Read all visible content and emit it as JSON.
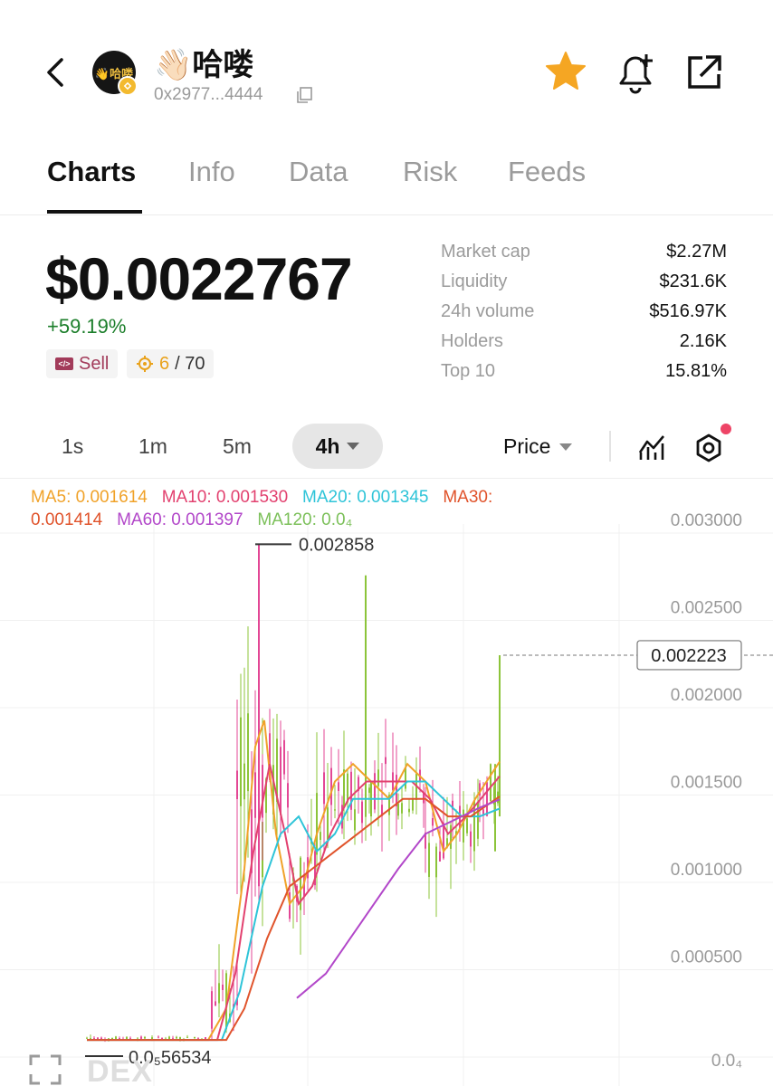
{
  "header": {
    "token_name": "👋🏻哈喽",
    "avatar_text": "👋哈喽",
    "address": "0x2977...4444"
  },
  "tabs": [
    {
      "label": "Charts",
      "active": true
    },
    {
      "label": "Info"
    },
    {
      "label": "Data"
    },
    {
      "label": "Risk"
    },
    {
      "label": "Feeds"
    }
  ],
  "summary": {
    "price": "$0.0022767",
    "change": "+59.19%",
    "sell_label": "Sell",
    "score_value": "6",
    "score_total": "/ 70"
  },
  "stats": [
    {
      "label": "Market cap",
      "value": "$2.27M"
    },
    {
      "label": "Liquidity",
      "value": "$231.6K"
    },
    {
      "label": "24h volume",
      "value": "$516.97K"
    },
    {
      "label": "Holders",
      "value": "2.16K"
    },
    {
      "label": "Top 10",
      "value": "15.81%"
    }
  ],
  "timeframes": [
    "1s",
    "1m",
    "5m"
  ],
  "active_timeframe": "4h",
  "price_select": "Price",
  "ma_legend": {
    "ma5": "MA5: 0.001614",
    "ma10": "MA10: 0.001530",
    "ma20": "MA20: 0.001345",
    "ma30_a": "MA30:",
    "ma30_b": "0.001414",
    "ma60": "MA60: 0.001397",
    "ma120": "MA120: 0.0₄"
  },
  "colors": {
    "ma5": "#f0a229",
    "ma10": "#e2416f",
    "ma20": "#2ec4d8",
    "ma30": "#e0532b",
    "ma60": "#b247c9",
    "ma120": "#7cc05a",
    "up": "#8cc43a",
    "down": "#e34795",
    "star": "#f5a623",
    "badge": "#f3ba2f"
  },
  "watermark": "DEX",
  "chart_data": {
    "type": "candlestick",
    "y_ticks": [
      "0.003000",
      "0.002500",
      "0.002000",
      "0.001500",
      "0.001000",
      "0.000500",
      "0.0₄"
    ],
    "ylim": [
      0,
      0.003
    ],
    "high_label": "0.002858",
    "low_label": "0.0₅56534",
    "current_price_label": "0.002223",
    "current_price": 0.002223
  }
}
